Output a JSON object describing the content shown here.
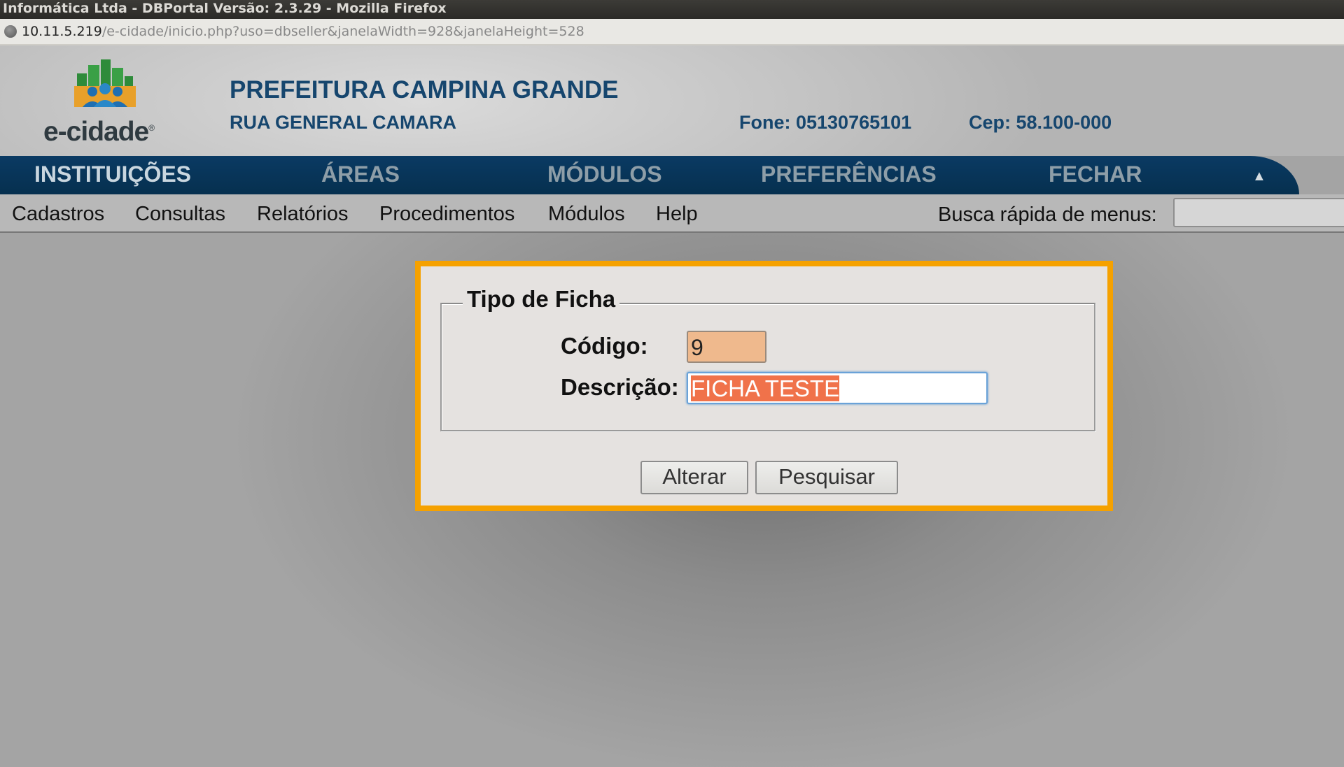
{
  "window": {
    "title": "Informática Ltda - DBPortal Versão: 2.3.29 - Mozilla Firefox"
  },
  "address_bar": {
    "host": "10.11.5.219",
    "path": "/e-cidade/inicio.php?uso=dbseller&janelaWidth=928&janelaHeight=528"
  },
  "header": {
    "logo_text": "e-cidade",
    "logo_mark": "®",
    "title": "PREFEITURA CAMPINA GRANDE",
    "address": "RUA GENERAL CAMARA",
    "fone": "Fone: 05130765101",
    "cep": "Cep: 58.100-000"
  },
  "main_nav": {
    "items": [
      "INSTITUIÇÕES",
      "ÁREAS",
      "MÓDULOS",
      "PREFERÊNCIAS",
      "FECHAR"
    ],
    "collapse_icon": "▲"
  },
  "sub_menu": {
    "items": [
      "Cadastros",
      "Consultas",
      "Relatórios",
      "Procedimentos",
      "Módulos",
      "Help"
    ],
    "search_label": "Busca rápida de menus:",
    "search_value": ""
  },
  "dialog": {
    "legend": "Tipo de Ficha",
    "codigo_label": "Código:",
    "codigo_value": "9",
    "descricao_label": "Descrição:",
    "descricao_value": "FICHA TESTE",
    "buttons": {
      "alterar": "Alterar",
      "pesquisar": "Pesquisar"
    }
  },
  "colors": {
    "accent_border": "#f5a100",
    "nav_bg": "#0a3a63",
    "header_text": "#16466e",
    "codigo_bg": "#efb98d",
    "selection": "#f0724a"
  }
}
